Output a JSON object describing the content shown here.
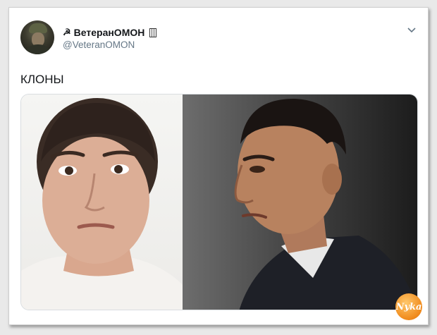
{
  "tweet": {
    "display_name": "ВетеранОМОН",
    "name_prefix_icon": "hammer-sickle-icon",
    "name_suffix_icon": "flag-icon",
    "handle": "@VeteranOMON",
    "text": "КЛОНЫ",
    "menu_icon": "chevron-down-icon"
  },
  "media": {
    "left_photo": "woman-portrait",
    "right_photo": "man-portrait",
    "watermark_text": "Nyka"
  },
  "colors": {
    "text_primary": "#14171a",
    "text_secondary": "#657786",
    "watermark": "#f08a1c"
  }
}
